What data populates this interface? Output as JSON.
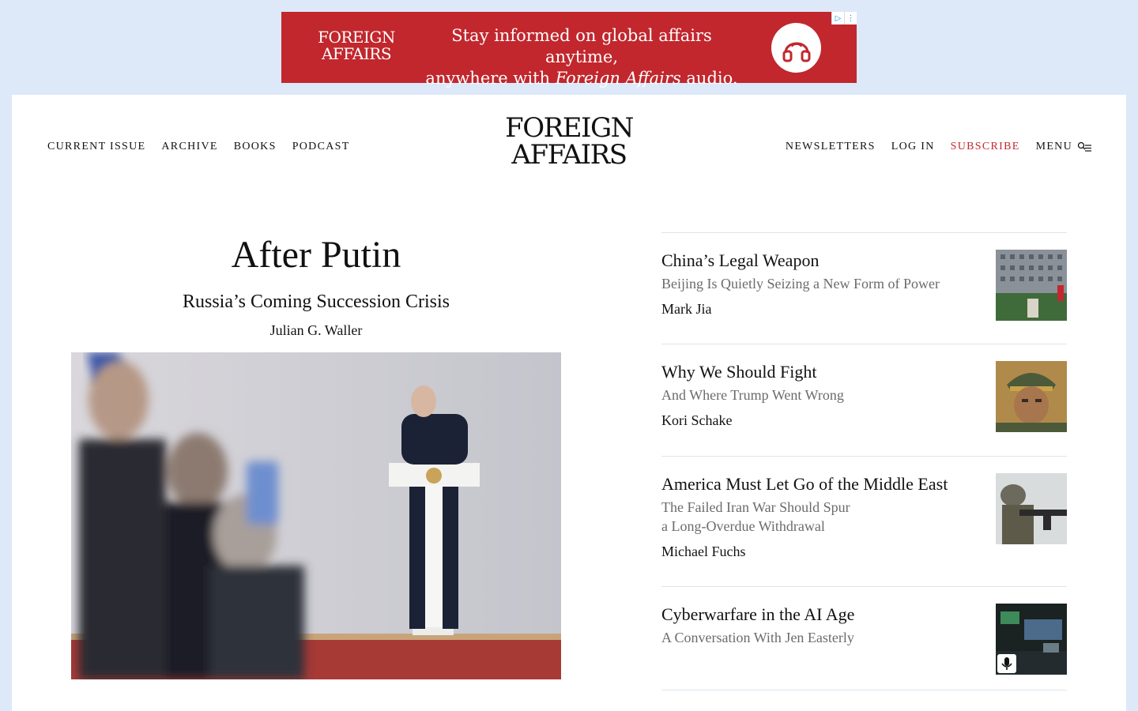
{
  "ad": {
    "logo_line1": "FOREIGN",
    "logo_line2": "AFFAIRS",
    "text_line1": "Stay informed on global affairs anytime,",
    "text_pre": "anywhere with ",
    "text_em": "Foreign Affairs",
    "text_post": " audio.",
    "icon": "headphones-icon",
    "choices_icons": [
      "adchoices-icon",
      "ad-menu-icon"
    ]
  },
  "nav": {
    "left": [
      "CURRENT ISSUE",
      "ARCHIVE",
      "BOOKS",
      "PODCAST"
    ],
    "right": [
      "NEWSLETTERS",
      "LOG IN",
      "SUBSCRIBE",
      "MENU"
    ],
    "menu_icon": "search-menu-icon"
  },
  "logo": {
    "line1": "FOREIGN",
    "line2": "AFFAIRS"
  },
  "feature": {
    "title": "After Putin",
    "subtitle": "Russia’s Coming Succession Crisis",
    "author": "Julian G. Waller"
  },
  "stories": [
    {
      "title": "China’s Legal Weapon",
      "subtitle": "Beijing Is Quietly Seizing a New Form of Power",
      "author": "Mark Jia"
    },
    {
      "title": "Why We Should Fight",
      "subtitle": "And Where Trump Went Wrong",
      "author": "Kori Schake"
    },
    {
      "title": "America Must Let Go of the Middle East",
      "subtitle_line1": "The Failed Iran War Should Spur",
      "subtitle_line2": "a Long-Overdue Withdrawal",
      "author": "Michael Fuchs"
    },
    {
      "title": "Cyberwarfare in the AI Age",
      "subtitle": "A Conversation With Jen Easterly",
      "thumb_icon": "microphone-icon"
    }
  ],
  "colors": {
    "accent_red": "#c4282e",
    "ad_red": "#c1272d",
    "page_bg": "#dde9f8"
  }
}
